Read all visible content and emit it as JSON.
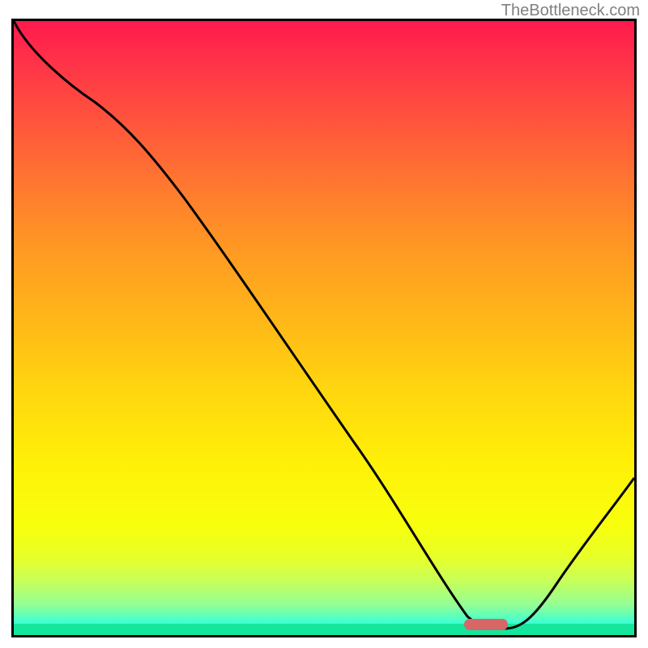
{
  "watermark": "TheBottleneck.com",
  "chart_data": {
    "type": "line",
    "title": "",
    "xlabel": "",
    "ylabel": "",
    "xlim": [
      0,
      100
    ],
    "ylim": [
      0,
      100
    ],
    "grid": false,
    "legend": false,
    "series": [
      {
        "name": "bottleneck-curve",
        "x": [
          0,
          4,
          12,
          22,
          33,
          48,
          62,
          70,
          75,
          79,
          83,
          88,
          93,
          100
        ],
        "y": [
          100,
          96,
          88,
          78,
          67,
          47,
          27,
          13,
          4,
          1,
          1,
          6,
          14,
          26
        ]
      }
    ],
    "marker": {
      "name": "optimal-region",
      "x_start": 74,
      "x_end": 81,
      "y": 1
    },
    "background": {
      "top_color": "#ff1a4d",
      "mid_color": "#fff008",
      "bottom_color": "#14e69d"
    }
  }
}
